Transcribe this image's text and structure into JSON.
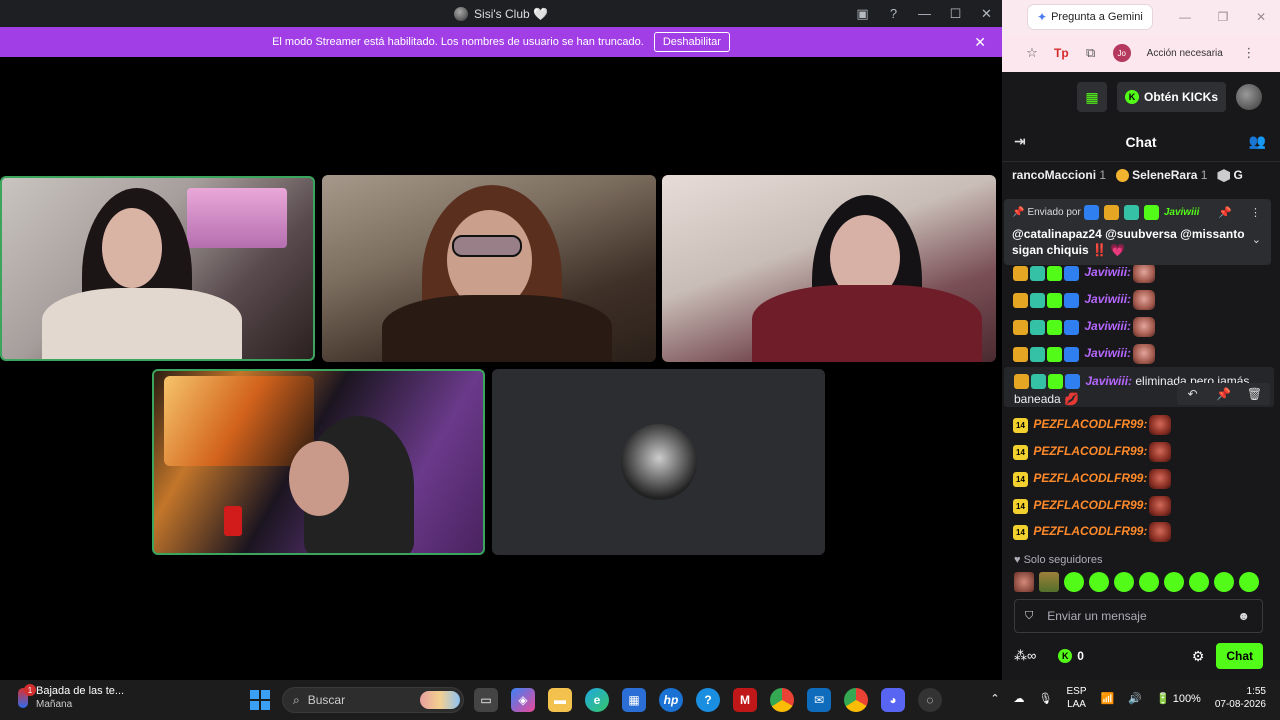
{
  "discord": {
    "window_title": "Sisi's Club 🤍",
    "streamer_banner": "El modo Streamer está habilitado. Los nombres de usuario se han truncado.",
    "streamer_button": "Deshabilitar"
  },
  "browser": {
    "gemini_button": "Pregunta a Gemini",
    "profile_initials": "Jo",
    "action_text": "Acción necesaria",
    "tp_label": "Tp"
  },
  "kick": {
    "get_kicks": "Obtén KICKs",
    "chat_title": "Chat",
    "top_gifters": [
      {
        "name": "rancoMaccioni",
        "count": "1"
      },
      {
        "name": "SeleneRara",
        "count": "1"
      },
      {
        "name": "G",
        "count": ""
      }
    ],
    "pinned": {
      "sent_by": "Enviado por",
      "sender": "Javiwiii",
      "message": "@catalinapaz24 @suubversa @missanto sigan chiquis ‼️ 💗"
    },
    "messages": [
      {
        "user": "Javiwiii:",
        "text": ""
      },
      {
        "user": "Javiwiii:",
        "text": ""
      },
      {
        "user": "Javiwiii:",
        "text": ""
      },
      {
        "user": "Javiwiii:",
        "text": ""
      }
    ],
    "highlighted": {
      "user": "Javiwiii:",
      "text": " eliminada pero jamás baneada 💋"
    },
    "pez_messages": [
      {
        "badge": "14",
        "user": "PEZFLACODLFR99:"
      },
      {
        "badge": "14",
        "user": "PEZFLACODLFR99:"
      },
      {
        "badge": "14",
        "user": "PEZFLACODLFR99:"
      },
      {
        "badge": "14",
        "user": "PEZFLACODLFR99:"
      },
      {
        "badge": "14",
        "user": "PEZFLACODLFR99:"
      }
    ],
    "followers_only": "Solo seguidores",
    "input_placeholder": "Enviar un mensaje",
    "kick_balance": "0",
    "send_button": "Chat"
  },
  "taskbar": {
    "weather_title": "Bajada de las te...",
    "weather_sub": "Mañana",
    "weather_badge": "1",
    "search_placeholder": "Buscar",
    "lang_1": "ESP",
    "lang_2": "LAA",
    "battery": "100%",
    "time": "1:55",
    "date": "07-08-2026",
    "hp_label": "hp",
    "help_label": "?"
  },
  "colors": {
    "kick_green": "#53fc18",
    "streamer_purple": "#a23ee6",
    "speaking_green": "#3ba55d"
  }
}
